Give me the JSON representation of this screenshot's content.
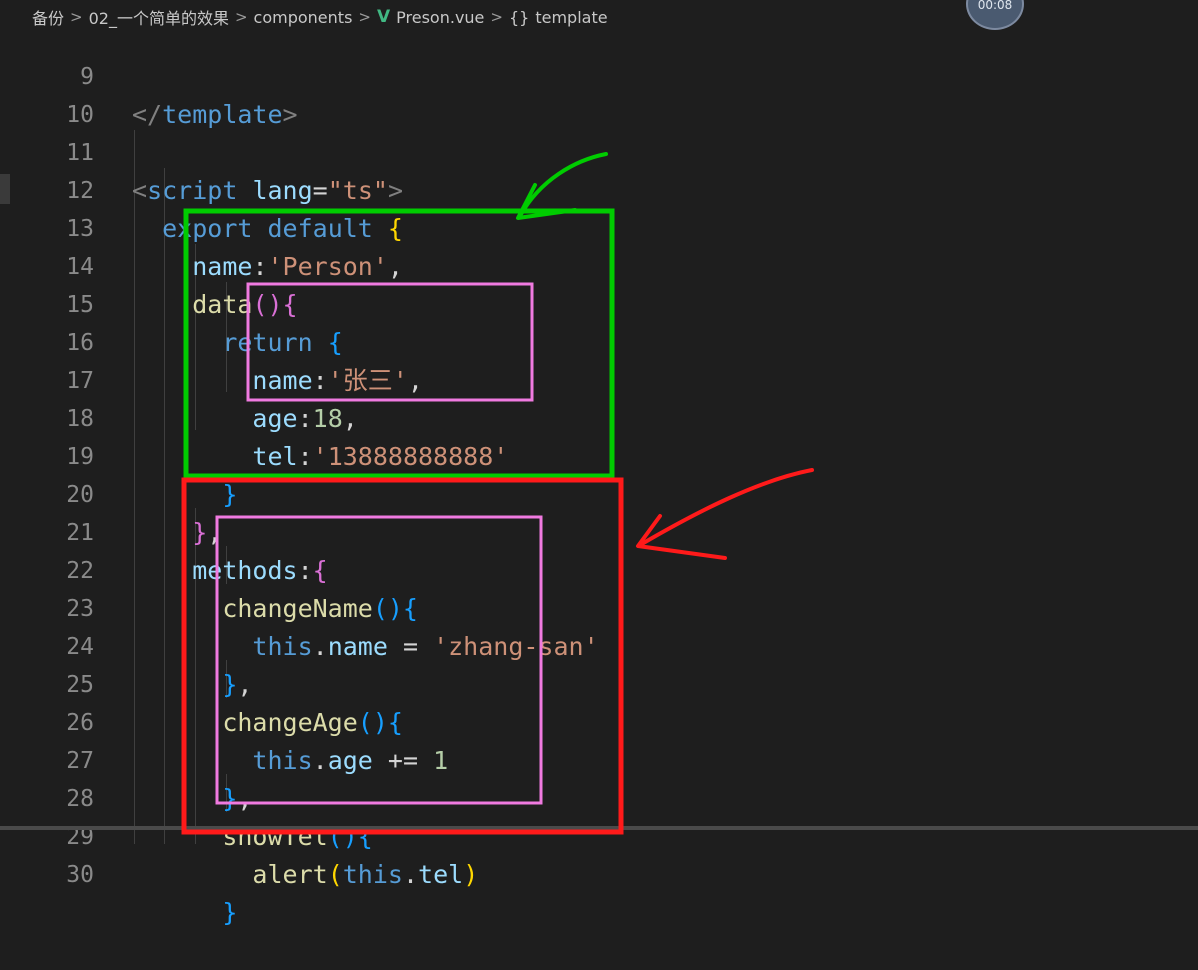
{
  "breadcrumb": {
    "items": [
      "备份",
      "02_一个简单的效果",
      "components",
      "Preson.vue",
      "template"
    ],
    "separator": ">",
    "vue_icon": "V",
    "braces": "{}"
  },
  "timer": {
    "text": "00:08"
  },
  "code_lines": [
    {
      "n": "9",
      "t": "</template>"
    },
    {
      "n": "10",
      "t": ""
    },
    {
      "n": "11",
      "t": "<script lang=\"ts\">"
    },
    {
      "n": "12",
      "t": "export default {"
    },
    {
      "n": "13",
      "t": "name:'Person',"
    },
    {
      "n": "14",
      "t": "data(){"
    },
    {
      "n": "15",
      "t": "return {"
    },
    {
      "n": "16",
      "t": "name:'张三',"
    },
    {
      "n": "17",
      "t": "age:18,"
    },
    {
      "n": "18",
      "t": "tel:'13888888888'"
    },
    {
      "n": "19",
      "t": "}"
    },
    {
      "n": "20",
      "t": "},"
    },
    {
      "n": "21",
      "t": "methods:{"
    },
    {
      "n": "22",
      "t": "changeName(){"
    },
    {
      "n": "23",
      "t": "this.name = 'zhang-san'"
    },
    {
      "n": "24",
      "t": "},"
    },
    {
      "n": "25",
      "t": "changeAge(){"
    },
    {
      "n": "26",
      "t": "this.age += 1"
    },
    {
      "n": "27",
      "t": "},"
    },
    {
      "n": "28",
      "t": "showTel(){"
    },
    {
      "n": "29",
      "t": "alert(this.tel)"
    },
    {
      "n": "30",
      "t": "}"
    }
  ],
  "annotations": {
    "green_color": "#00cc00",
    "red_color": "#ff1a1a",
    "pink_color": "#f07ae0"
  }
}
